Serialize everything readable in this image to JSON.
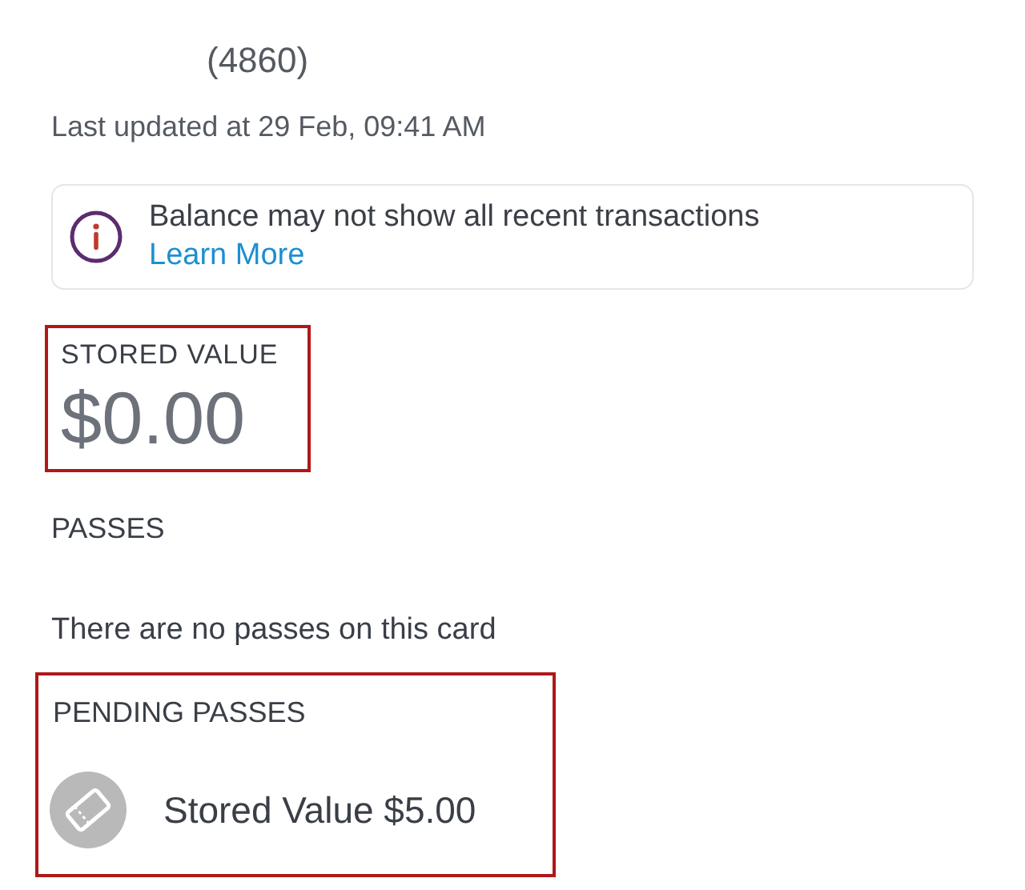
{
  "card_number": "(4860)",
  "last_updated": "Last updated at 29 Feb, 09:41 AM",
  "notice": {
    "message": "Balance may not show all recent transactions",
    "link": "Learn More"
  },
  "stored_value": {
    "label": "STORED VALUE",
    "amount": "$0.00",
    "highlighted": true
  },
  "passes": {
    "label": "PASSES",
    "empty_text": "There are no passes on this card"
  },
  "pending_passes": {
    "label": "PENDING PASSES",
    "highlighted": true,
    "items": [
      {
        "name": "Stored Value $5.00"
      }
    ]
  }
}
